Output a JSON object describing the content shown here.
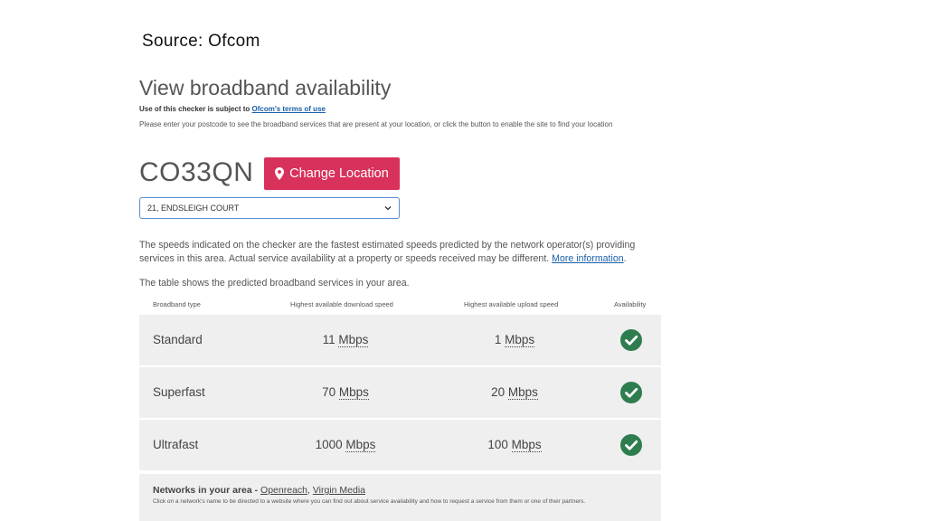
{
  "source": "Source: Ofcom",
  "title": "View broadband availability",
  "terms": {
    "prefix": "Use of this checker is subject to ",
    "link": "Ofcom's terms of use"
  },
  "instructions": "Please enter your postcode to see the broadband services that are present at your location, or click the button to enable the site to find your location",
  "postcode": "CO33QN",
  "change_location_label": "Change Location",
  "address_select": {
    "selected": "21, ENDSLEIGH COURT"
  },
  "disclaimer": {
    "text": "The speeds indicated on the checker are the fastest estimated speeds predicted by the network operator(s) providing services in this area. Actual service availability at a property or speeds received may be different. ",
    "link": "More information",
    "suffix": "."
  },
  "table_intro": "The table shows the predicted broadband services in your area.",
  "table": {
    "headers": [
      "Broadband type",
      "Highest available download speed",
      "Highest available upload speed",
      "Availability"
    ],
    "rows": [
      {
        "type": "Standard",
        "download": "11",
        "download_unit": "Mbps",
        "upload": "1",
        "upload_unit": "Mbps",
        "available": true
      },
      {
        "type": "Superfast",
        "download": "70",
        "download_unit": "Mbps",
        "upload": "20",
        "upload_unit": "Mbps",
        "available": true
      },
      {
        "type": "Ultrafast",
        "download": "1000",
        "download_unit": "Mbps",
        "upload": "100",
        "upload_unit": "Mbps",
        "available": true
      }
    ]
  },
  "networks": {
    "label": "Networks in your area - ",
    "items": [
      "Openreach",
      "Virgin Media"
    ],
    "separator": ", ",
    "note": "Click on a network's name to be directed to a website where you can find out about service availability and how to request a service from them or one of their partners."
  },
  "colors": {
    "accent": "#d8315b",
    "check": "#2e7d4f",
    "link": "#1a5fa8",
    "row_bg": "#efefef"
  },
  "icons": {
    "change_location": "map-pin-icon",
    "availability": "check-circle-icon",
    "select": "chevron-down-icon"
  }
}
